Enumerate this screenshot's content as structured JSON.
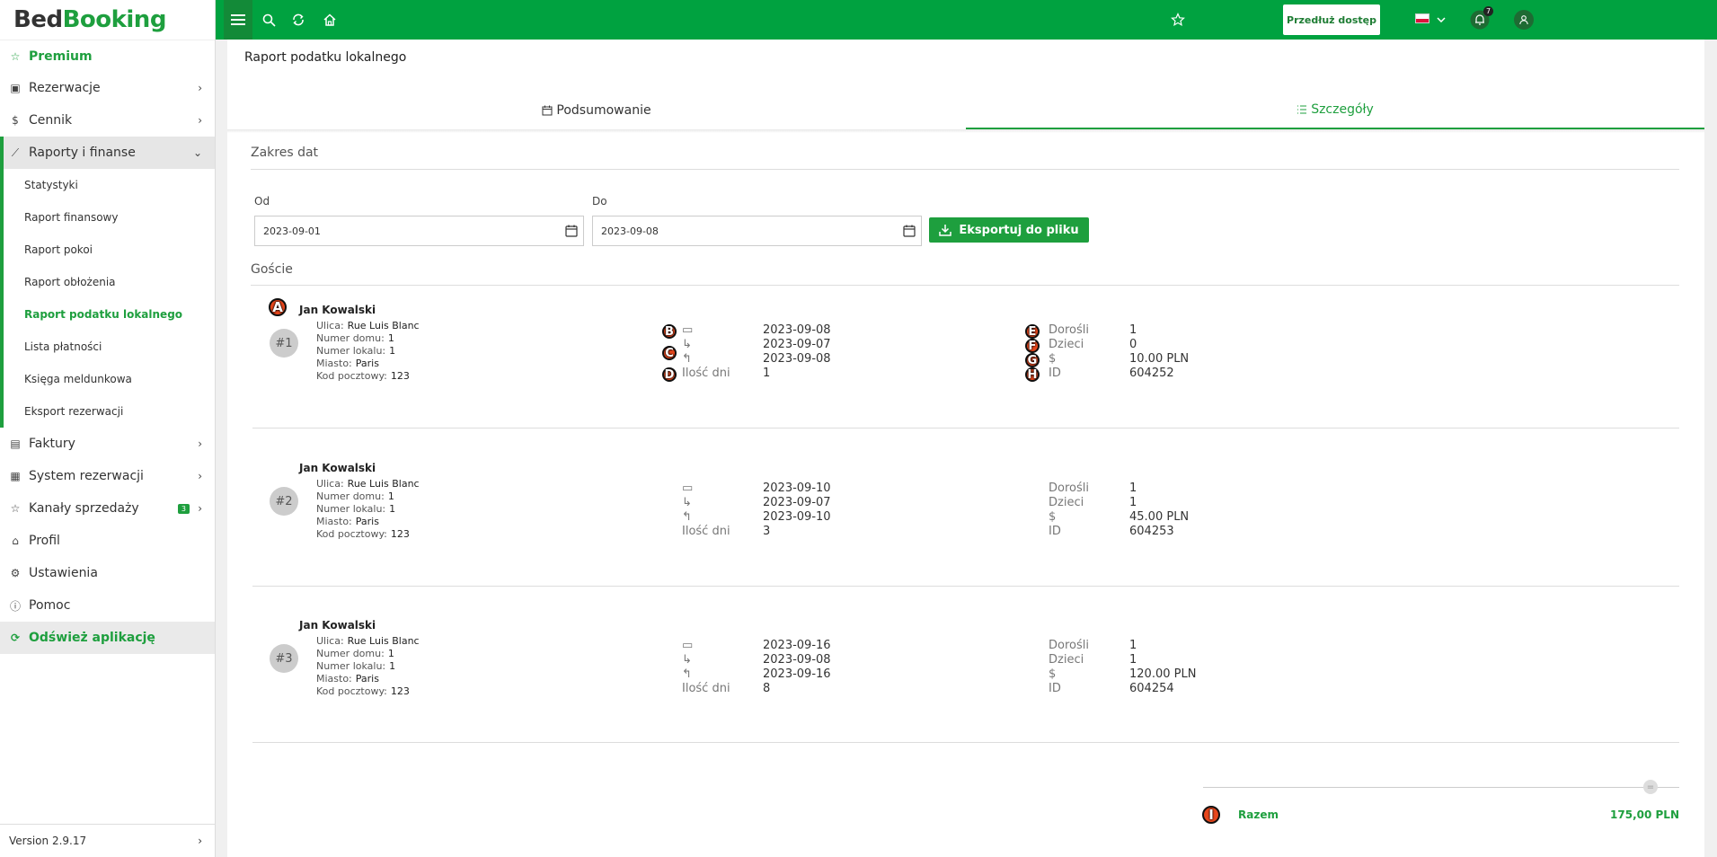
{
  "brand": {
    "part1": "Bed",
    "part2": "Booking"
  },
  "sidebar": {
    "items": [
      {
        "label": "Premium"
      },
      {
        "label": "Rezerwacje"
      },
      {
        "label": "Cennik"
      },
      {
        "label": "Raporty i finanse"
      },
      {
        "label": "Faktury"
      },
      {
        "label": "System rezerwacji"
      },
      {
        "label": "Kanały sprzedaży",
        "badge": "3"
      },
      {
        "label": "Profil"
      },
      {
        "label": "Ustawienia"
      },
      {
        "label": "Pomoc"
      },
      {
        "label": "Odśwież aplikację"
      }
    ],
    "sub_items": [
      {
        "label": "Statystyki"
      },
      {
        "label": "Raport finansowy"
      },
      {
        "label": "Raport pokoi"
      },
      {
        "label": "Raport obłożenia"
      },
      {
        "label": "Raport podatku lokalnego"
      },
      {
        "label": "Lista płatności"
      },
      {
        "label": "Księga meldunkowa"
      },
      {
        "label": "Eksport rezerwacji"
      }
    ],
    "version": "Version 2.9.17"
  },
  "topbar": {
    "extend_label": "Przedłuż dostęp",
    "notifications_count": "7"
  },
  "page": {
    "title": "Raport podatku lokalnego",
    "tabs": [
      {
        "label": "Podsumowanie"
      },
      {
        "label": "Szczegóły"
      }
    ],
    "date_range_title": "Zakres dat",
    "from_label": "Od",
    "to_label": "Do",
    "from_value": "2023-09-01",
    "to_value": "2023-09-08",
    "export_label": "Eksportuj do pliku",
    "guests_title": "Goście"
  },
  "address_labels": {
    "street": "Ulica:",
    "house": "Numer domu:",
    "unit": "Numer lokalu:",
    "city": "Miasto:",
    "zip": "Kod pocztowy:"
  },
  "stay_labels": {
    "days": "Ilość dni"
  },
  "stat_labels": {
    "adults": "Dorośli",
    "children": "Dzieci",
    "price": "$",
    "id": "ID"
  },
  "guests": [
    {
      "name": "Jan Kowalski",
      "number": "#1",
      "street": "Rue Luis Blanc",
      "house": "1",
      "unit": "1",
      "city": "Paris",
      "zip": "123",
      "booked": "2023-09-08",
      "checkin": "2023-09-07",
      "checkout": "2023-09-08",
      "days": "1",
      "adults": "1",
      "children": "0",
      "price": "10.00 PLN",
      "id": "604252"
    },
    {
      "name": "Jan Kowalski",
      "number": "#2",
      "street": "Rue Luis Blanc",
      "house": "1",
      "unit": "1",
      "city": "Paris",
      "zip": "123",
      "booked": "2023-09-10",
      "checkin": "2023-09-07",
      "checkout": "2023-09-10",
      "days": "3",
      "adults": "1",
      "children": "1",
      "price": "45.00 PLN",
      "id": "604253"
    },
    {
      "name": "Jan Kowalski",
      "number": "#3",
      "street": "Rue Luis Blanc",
      "house": "1",
      "unit": "1",
      "city": "Paris",
      "zip": "123",
      "booked": "2023-09-16",
      "checkin": "2023-09-08",
      "checkout": "2023-09-16",
      "days": "8",
      "adults": "1",
      "children": "1",
      "price": "120.00 PLN",
      "id": "604254"
    }
  ],
  "total": {
    "label": "Razem",
    "value": "175,00 PLN"
  },
  "markers": [
    "A",
    "B",
    "C",
    "D",
    "E",
    "F",
    "G",
    "H",
    "I"
  ]
}
